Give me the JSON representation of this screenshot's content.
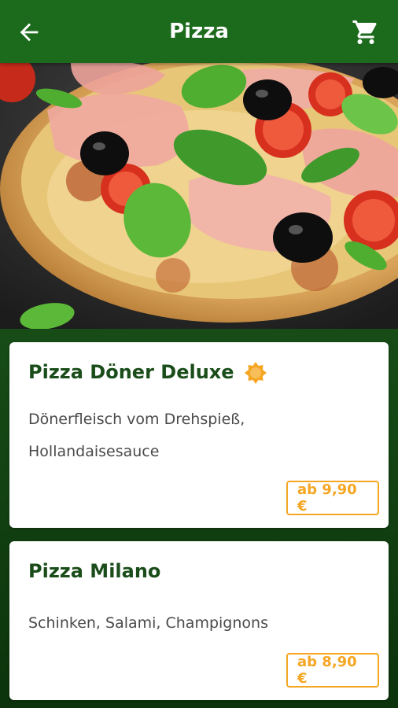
{
  "appbar": {
    "title": "Pizza",
    "back_icon": "arrow-back-icon",
    "cart_icon": "shopping-cart-icon"
  },
  "colors": {
    "appbar": "#1c6b1c",
    "background": "#0f3d0f",
    "accent": "#f5a623",
    "title_text": "#1a4d1a"
  },
  "products": [
    {
      "name": "Pizza Döner Deluxe",
      "description_lines": [
        "Dönerfleisch vom Drehspieß,",
        "Hollandaisesauce"
      ],
      "price": "ab 9,90 €",
      "badge_icon": "star-badge-icon"
    },
    {
      "name": "Pizza Milano",
      "description_lines": [
        "Schinken, Salami, Champignons"
      ],
      "price": "ab 8,90 €"
    }
  ]
}
